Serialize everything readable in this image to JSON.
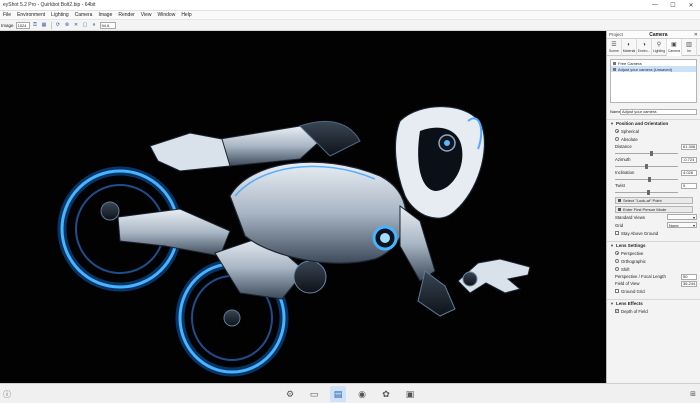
{
  "window": {
    "title": "eyShot 5.2 Pro - Quirkbot Bolt2.bip - 64bit",
    "controls": [
      "—",
      "☐",
      "✕"
    ]
  },
  "menu": [
    "File",
    "Environment",
    "Lighting",
    "Camera",
    "Image",
    "Render",
    "View",
    "Window",
    "Help"
  ],
  "toolbar": {
    "image_label": "Image",
    "image_value": "1024",
    "zoom_value": "94.6"
  },
  "panel": {
    "header_left": "Project",
    "header_title": "Camera",
    "header_right": "✕",
    "tabs": [
      {
        "icon": "scene-icon",
        "label": "Scene"
      },
      {
        "icon": "material-icon",
        "label": "Material"
      },
      {
        "icon": "environment-icon",
        "label": "Enviro..."
      },
      {
        "icon": "lighting-icon",
        "label": "Lighting"
      },
      {
        "icon": "camera-icon",
        "label": "Camera"
      },
      {
        "icon": "image-icon",
        "label": "Im"
      }
    ],
    "camera_list": [
      "Free Camera",
      "Adjust your camera (Unsaved)"
    ],
    "name_label": "Name",
    "name_value": "Adjust your camera",
    "section_position": "Position and Orientation",
    "radio_spherical": "Spherical",
    "radio_absolute": "Absolute",
    "fields": [
      {
        "label": "Distance",
        "value": "61.306",
        "knob_fraction": 0.55
      },
      {
        "label": "Azimuth",
        "value": "-0.724",
        "knob_fraction": 0.48
      },
      {
        "label": "Inclination",
        "value": "4.026",
        "knob_fraction": 0.52
      },
      {
        "label": "Twist",
        "value": "0",
        "knob_fraction": 0.5
      }
    ],
    "btn_lookat": "Select \"Look-at\" Point",
    "btn_firstperson": "Enter First Person Mode",
    "standard_views_label": "Standard Views",
    "standard_views_value": "",
    "grid_label": "Grid",
    "grid_value": "None",
    "stay_above_ground": "Stay Above Ground",
    "section_lens": "Lens Settings",
    "radio_perspective": "Perspective",
    "radio_ortho": "Orthographic",
    "radio_shift": "Shift",
    "focal_label": "Perspective / Focal Length",
    "focal_value": "50",
    "fov_label": "Field of View",
    "fov_value": "36.244",
    "ground_grid": "Ground Grid",
    "section_effects": "Lens Effects",
    "depth_of_field": "Depth of Field"
  },
  "status": {
    "left_icon": "ⓘ",
    "tools": [
      "⚙",
      "▭",
      "▤",
      "◉",
      "✿",
      "▣"
    ],
    "right_icon": "⊞"
  }
}
